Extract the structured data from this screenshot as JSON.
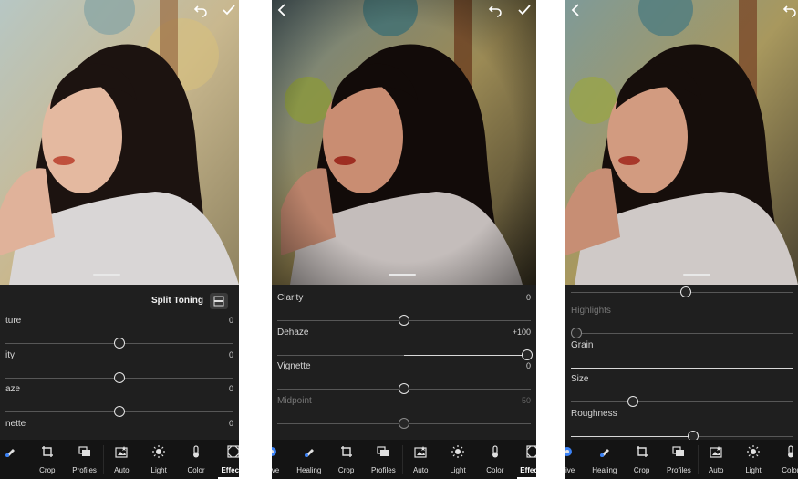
{
  "panels": [
    {
      "section_title": "Split Toning",
      "top_actions": [
        "undo-icon",
        "check-icon"
      ],
      "sliders": [
        {
          "label": "ture",
          "value": "0",
          "position": 0.5,
          "dim": false
        },
        {
          "label": "ity",
          "value": "0",
          "position": 0.5,
          "dim": false
        },
        {
          "label": "aze",
          "value": "0",
          "position": 0.5,
          "dim": false
        },
        {
          "label": "nette",
          "value": "0",
          "position": 0.5,
          "dim": false
        }
      ],
      "toolbar": [
        {
          "label": "",
          "icon": "healing-icon"
        },
        {
          "label": "Crop",
          "icon": "crop-icon"
        },
        {
          "label": "Profiles",
          "icon": "profiles-icon"
        },
        {
          "label": "Auto",
          "icon": "auto-icon"
        },
        {
          "label": "Light",
          "icon": "light-icon"
        },
        {
          "label": "Color",
          "icon": "color-icon"
        },
        {
          "label": "Effects",
          "icon": "effects-icon",
          "active": true
        }
      ]
    },
    {
      "top_actions": [
        "back-icon",
        "undo-icon",
        "check-icon"
      ],
      "sliders": [
        {
          "label": "Clarity",
          "value": "0",
          "position": 0.5,
          "dim": false
        },
        {
          "label": "Dehaze",
          "value": "+100",
          "position": 1.0,
          "dim": false
        },
        {
          "label": "Vignette",
          "value": "0",
          "position": 0.5,
          "dim": false
        },
        {
          "label": "Midpoint",
          "value": "50",
          "position": 0.5,
          "dim": true
        }
      ],
      "toolbar": [
        {
          "label": "ctive",
          "icon": "selective-icon"
        },
        {
          "label": "Healing",
          "icon": "healing-icon"
        },
        {
          "label": "Crop",
          "icon": "crop-icon"
        },
        {
          "label": "Profiles",
          "icon": "profiles-icon"
        },
        {
          "label": "Auto",
          "icon": "auto-icon"
        },
        {
          "label": "Light",
          "icon": "light-icon"
        },
        {
          "label": "Color",
          "icon": "color-icon"
        },
        {
          "label": "Effects",
          "icon": "effects-icon",
          "active": true
        }
      ]
    },
    {
      "top_actions": [
        "back-icon",
        "undo-icon"
      ],
      "sliders": [
        {
          "label": "Highlights",
          "value": "",
          "position": 0.0,
          "dim": true
        },
        {
          "label": "Grain",
          "value": "",
          "position": 1.0,
          "dim": false
        },
        {
          "label": "Size",
          "value": "",
          "position": 0.28,
          "dim": false
        },
        {
          "label": "Roughness",
          "value": "",
          "position": 0.55,
          "dim": false
        }
      ],
      "toolbar": [
        {
          "label": "ctive",
          "icon": "selective-icon"
        },
        {
          "label": "Healing",
          "icon": "healing-icon"
        },
        {
          "label": "Crop",
          "icon": "crop-icon"
        },
        {
          "label": "Profiles",
          "icon": "profiles-icon"
        },
        {
          "label": "Auto",
          "icon": "auto-icon"
        },
        {
          "label": "Light",
          "icon": "light-icon"
        },
        {
          "label": "Color",
          "icon": "color-icon"
        }
      ]
    }
  ]
}
